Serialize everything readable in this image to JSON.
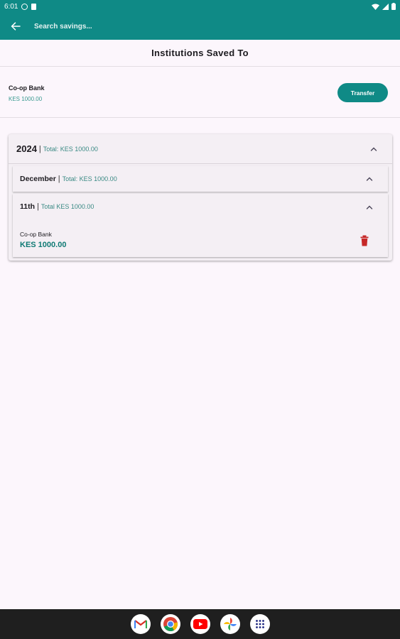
{
  "status_bar": {
    "time": "6:01"
  },
  "app_bar": {
    "search_placeholder": "Search savings..."
  },
  "page": {
    "title": "Institutions Saved To"
  },
  "institution": {
    "name": "Co-op Bank",
    "amount": "KES 1000.00",
    "transfer_label": "Transfer"
  },
  "year_group": {
    "year": "2024",
    "separator": "|",
    "total": "Total: KES 1000.00",
    "month_group": {
      "month": "December",
      "separator": "|",
      "total": "Total: KES 1000.00",
      "day_group": {
        "day": "11th",
        "separator": "|",
        "total": "Total KES 1000.00",
        "entry": {
          "name": "Co-op Bank",
          "amount": "KES 1000.00"
        }
      }
    }
  },
  "nav_bar": {
    "apps": [
      "gmail-icon",
      "chrome-icon",
      "youtube-icon",
      "photos-icon",
      "app-drawer-icon"
    ]
  },
  "colors": {
    "teal": "#0f8a86",
    "background": "#fcf6fc",
    "card": "#f4eff4",
    "delete_red": "#c62828"
  }
}
